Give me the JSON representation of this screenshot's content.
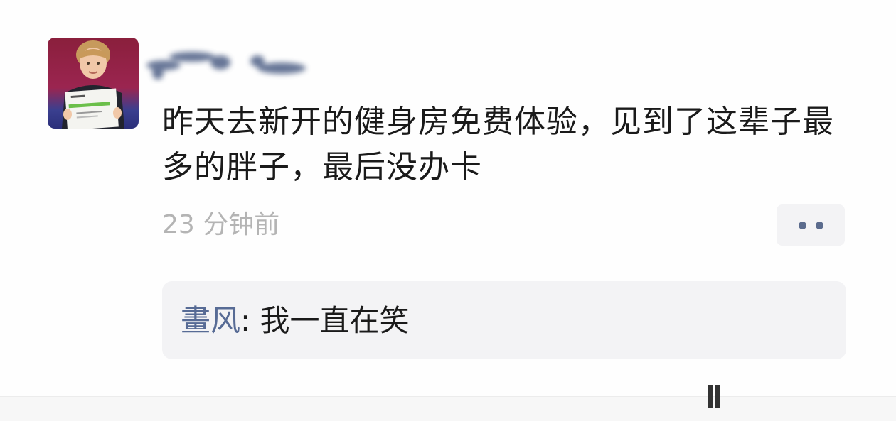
{
  "post": {
    "username": "",
    "text": "昨天去新开的健身房免费体验，见到了这辈子最多的胖子，最后没办卡",
    "timestamp": "23 分钟前",
    "more_button_icon": "more-dots-icon"
  },
  "comments": [
    {
      "author": "畫风",
      "separator": ": ",
      "text": "我一直在笑"
    }
  ],
  "colors": {
    "author_link": "#576b95",
    "timestamp": "#b4b4b4",
    "comment_bg": "#f3f3f5",
    "body_text": "#1a1a1a"
  }
}
